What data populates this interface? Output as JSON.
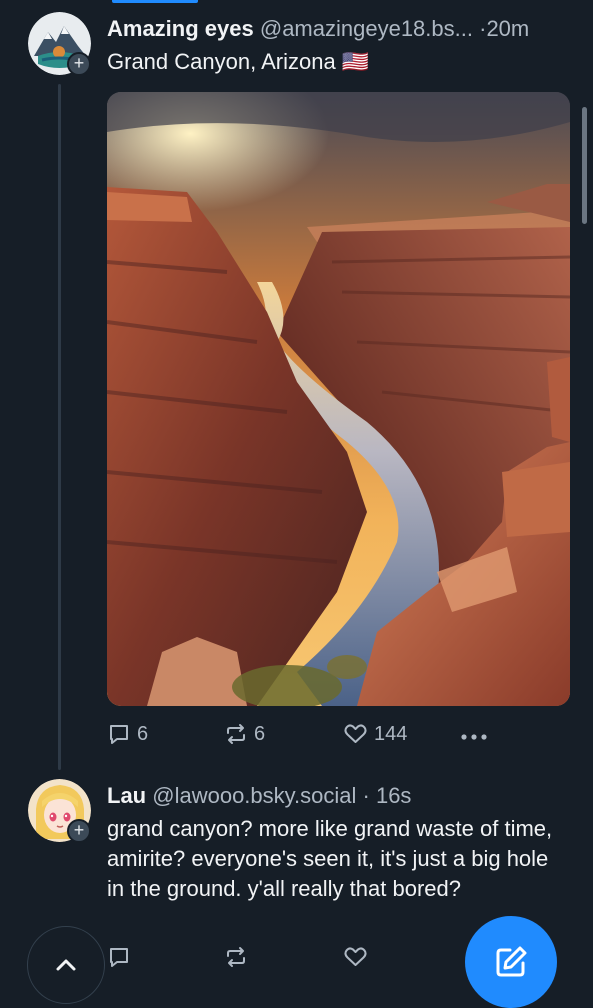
{
  "post1": {
    "author_name": "Amazing eyes",
    "handle": "@amazingeye18.bs...",
    "separator": "·",
    "time": "20m",
    "text": "Grand Canyon, Arizona 🇺🇸",
    "image_alt": "Grand Canyon at sunset with river",
    "reply_count": "6",
    "repost_count": "6",
    "like_count": "144"
  },
  "post2": {
    "author_name": "Lau",
    "handle": "@lawooo.bsky.social",
    "separator": "·",
    "time": "16s",
    "text": "grand canyon? more like grand waste of time, amirite? everyone's seen it, it's just a big hole in the ground. y'all really that bored?"
  },
  "icons": {
    "reply": "reply-icon",
    "repost": "repost-icon",
    "like": "heart-icon",
    "more": "more-icon",
    "compose": "compose-icon",
    "scroll_top": "chevron-up-icon",
    "follow": "plus-icon"
  },
  "colors": {
    "background": "#161e27",
    "accent": "#208bfe",
    "muted": "#aeb8c3"
  }
}
